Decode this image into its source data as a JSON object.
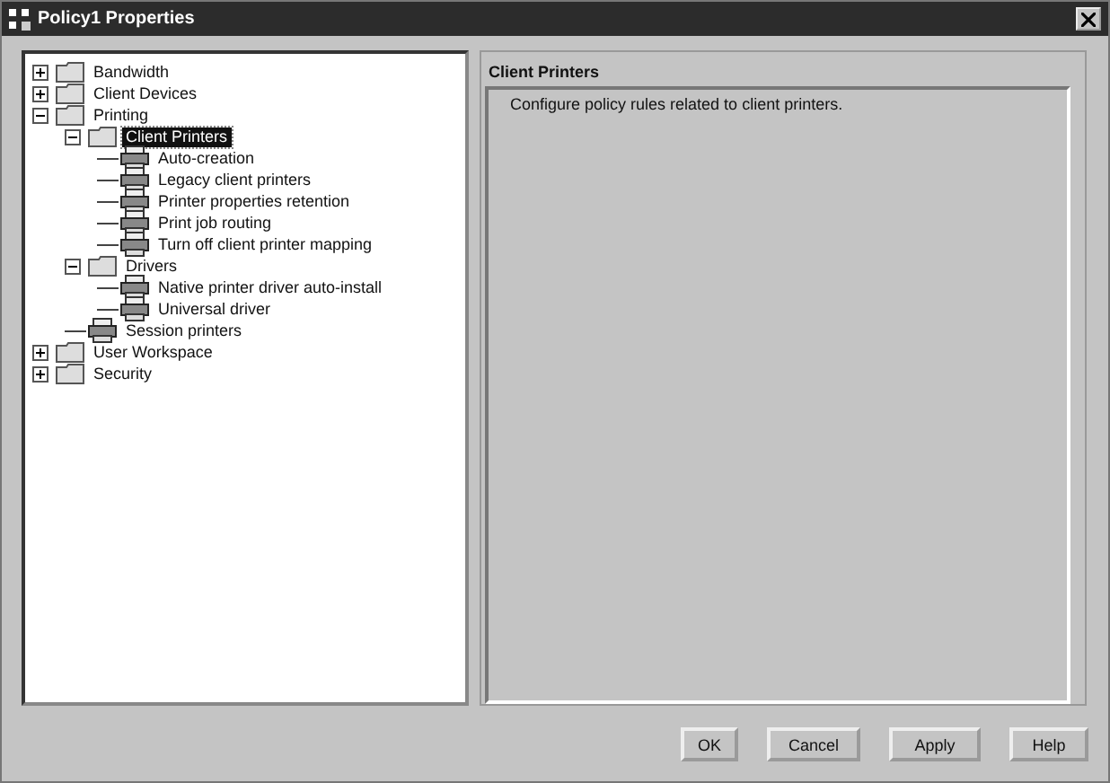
{
  "window": {
    "title": "Policy1 Properties"
  },
  "tree": [
    {
      "label": "Bandwidth",
      "kind": "folder",
      "expanded": false,
      "selected": false
    },
    {
      "label": "Client Devices",
      "kind": "folder",
      "expanded": false,
      "selected": false
    },
    {
      "label": "Printing",
      "kind": "folder",
      "expanded": true,
      "selected": false,
      "children": [
        {
          "label": "Client Printers",
          "kind": "folder",
          "expanded": true,
          "selected": true,
          "children": [
            {
              "label": "Auto-creation",
              "kind": "printer",
              "selected": false
            },
            {
              "label": "Legacy client printers",
              "kind": "printer",
              "selected": false
            },
            {
              "label": "Printer properties retention",
              "kind": "printer",
              "selected": false
            },
            {
              "label": "Print job routing",
              "kind": "printer",
              "selected": false
            },
            {
              "label": "Turn off client printer mapping",
              "kind": "printer",
              "selected": false
            }
          ]
        },
        {
          "label": "Drivers",
          "kind": "folder",
          "expanded": true,
          "selected": false,
          "children": [
            {
              "label": "Native printer driver auto-install",
              "kind": "printer",
              "selected": false
            },
            {
              "label": "Universal driver",
              "kind": "printer",
              "selected": false
            }
          ]
        },
        {
          "label": "Session printers",
          "kind": "printer",
          "selected": false
        }
      ]
    },
    {
      "label": "User Workspace",
      "kind": "folder",
      "expanded": false,
      "selected": false
    },
    {
      "label": "Security",
      "kind": "folder",
      "expanded": false,
      "selected": false
    }
  ],
  "detail": {
    "title": "Client Printers",
    "description": "Configure policy rules related to client printers."
  },
  "buttons": [
    "OK",
    "Cancel",
    "Apply",
    "Help"
  ]
}
